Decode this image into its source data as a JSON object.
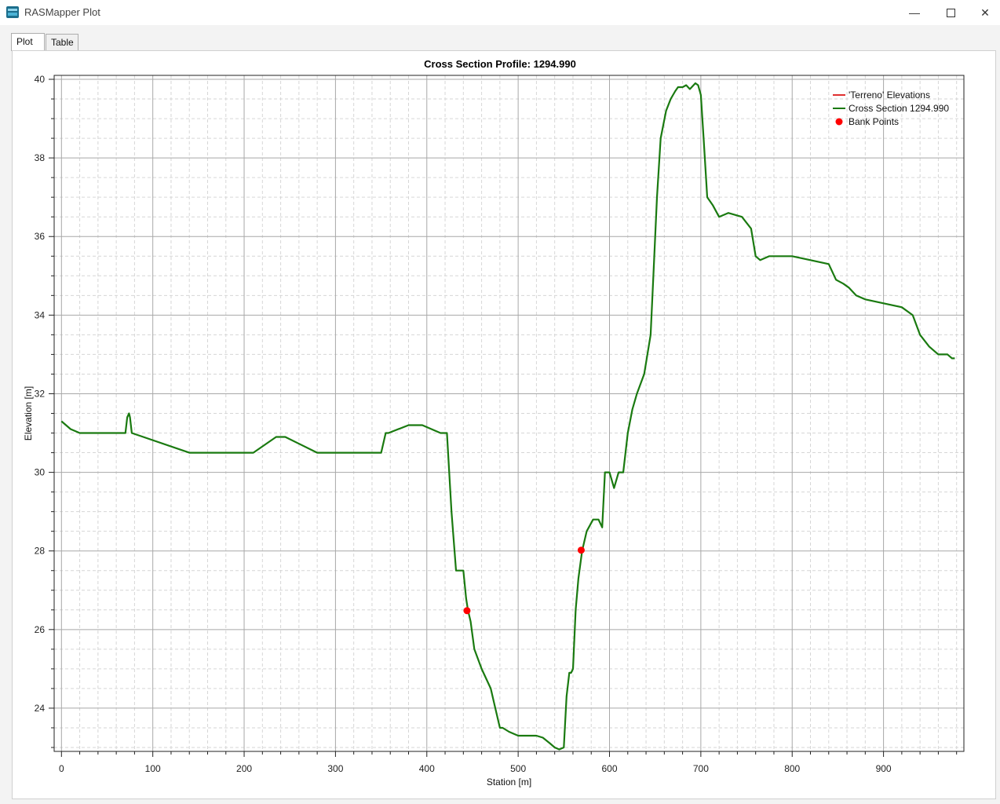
{
  "window": {
    "title": "RASMapper Plot",
    "minimize": "—",
    "close": "✕"
  },
  "tabs": [
    {
      "label": "Plot",
      "active": true
    },
    {
      "label": "Table",
      "active": false
    }
  ],
  "chart_data": {
    "type": "line",
    "title": "Cross Section Profile: 1294.990",
    "xlabel": "Station [m]",
    "ylabel": "Elevation [m]",
    "xlim": [
      -8,
      988
    ],
    "ylim": [
      22.9,
      40.1
    ],
    "xticks": [
      0,
      100,
      200,
      300,
      400,
      500,
      600,
      700,
      800,
      900
    ],
    "yticks": [
      24,
      26,
      28,
      30,
      32,
      34,
      36,
      38,
      40
    ],
    "grid": true,
    "legend_position": "top-right",
    "legend": [
      {
        "label": "'Terreno' Elevations",
        "type": "line",
        "color": "#e03030"
      },
      {
        "label": "Cross Section 1294.990",
        "type": "line",
        "color": "#1a7a10"
      },
      {
        "label": "Bank Points",
        "type": "marker",
        "color": "#ff0000"
      }
    ],
    "series": [
      {
        "name": "Cross Section 1294.990",
        "color": "#1a7a10",
        "x": [
          0,
          10,
          20,
          25,
          30,
          70,
          72,
          74,
          75,
          77,
          140,
          210,
          235,
          240,
          245,
          280,
          300,
          350,
          355,
          358,
          380,
          390,
          395,
          415,
          422,
          427,
          432,
          436,
          440,
          443,
          445,
          448,
          452,
          460,
          470,
          475,
          480,
          483,
          490,
          500,
          510,
          520,
          527,
          535,
          540,
          545,
          550,
          553,
          556,
          558,
          560,
          563,
          566,
          570,
          575,
          582,
          588,
          592,
          595,
          600,
          605,
          610,
          615,
          620,
          625,
          630,
          638,
          645,
          648,
          652,
          656,
          662,
          667,
          672,
          675,
          680,
          684,
          688,
          694,
          697,
          700,
          703,
          707,
          713,
          720,
          730,
          745,
          755,
          760,
          765,
          775,
          800,
          840,
          848,
          856,
          862,
          870,
          880,
          900,
          920,
          932,
          940,
          950,
          960,
          970,
          975,
          978
        ],
        "y": [
          31.3,
          31.1,
          31.0,
          31.0,
          31.0,
          31.0,
          31.4,
          31.5,
          31.4,
          31.0,
          30.5,
          30.5,
          30.9,
          30.9,
          30.9,
          30.5,
          30.5,
          30.5,
          31.0,
          31.0,
          31.2,
          31.2,
          31.2,
          31.0,
          31.0,
          29.0,
          27.5,
          27.5,
          27.5,
          26.8,
          26.5,
          26.2,
          25.5,
          25.0,
          24.5,
          24.0,
          23.5,
          23.5,
          23.4,
          23.3,
          23.3,
          23.3,
          23.25,
          23.1,
          23.0,
          22.95,
          23.0,
          24.3,
          24.9,
          24.9,
          25.0,
          26.5,
          27.3,
          28.0,
          28.5,
          28.8,
          28.8,
          28.6,
          30.0,
          30.0,
          29.6,
          30.0,
          30.0,
          31.0,
          31.6,
          32.0,
          32.5,
          33.5,
          35.0,
          37.0,
          38.5,
          39.2,
          39.5,
          39.7,
          39.8,
          39.8,
          39.85,
          39.75,
          39.9,
          39.85,
          39.6,
          38.5,
          37.0,
          36.8,
          36.5,
          36.6,
          36.5,
          36.2,
          35.5,
          35.4,
          35.5,
          35.5,
          35.3,
          34.9,
          34.8,
          34.7,
          34.5,
          34.4,
          34.3,
          34.2,
          34.0,
          33.5,
          33.2,
          33.0,
          33.0,
          32.9,
          32.9
        ],
        "shown_in_legend": true
      },
      {
        "name": "'Terreno' Elevations",
        "color": "#e03030",
        "x": [],
        "y": []
      }
    ],
    "bank_points": {
      "name": "Bank Points",
      "color": "#ff0000",
      "points": [
        {
          "x": 444,
          "y": 26.48
        },
        {
          "x": 569,
          "y": 28.02
        }
      ]
    }
  }
}
